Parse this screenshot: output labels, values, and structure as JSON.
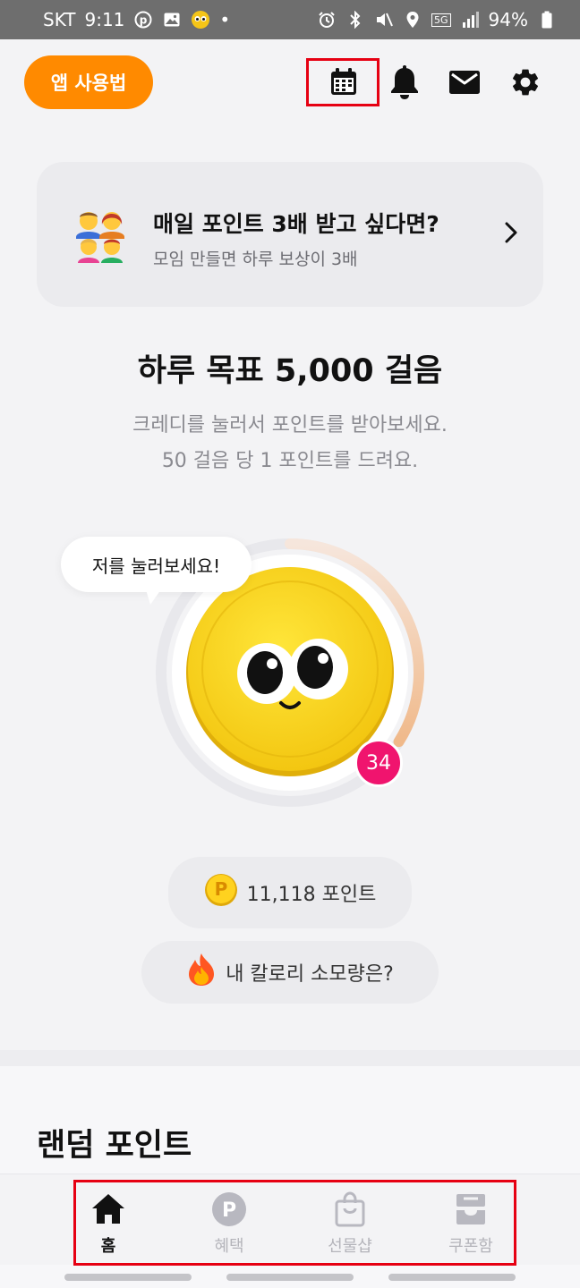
{
  "status_bar": {
    "carrier": "SKT",
    "time": "9:11",
    "notification_dot": "•",
    "battery": "94%",
    "network": "5G",
    "icons": [
      "p-circle-icon",
      "image-icon",
      "emoji-icon",
      "alarm-icon",
      "bluetooth-icon",
      "mute-icon",
      "location-icon",
      "signal-icon",
      "battery-icon"
    ]
  },
  "header": {
    "guide_button": "앱 사용법",
    "icons": [
      "calendar-icon",
      "bell-icon",
      "mail-icon",
      "gear-icon"
    ]
  },
  "promo": {
    "title": "매일 포인트 3배 받고 싶다면?",
    "subtitle": "모임 만들면 하루 보상이 3배",
    "emoji_icon": "family-icon"
  },
  "goal": {
    "title": "하루 목표 5,000 걸음",
    "desc_line1": "크레디를 눌러서 포인트를 받아보세요.",
    "desc_line2": "50 걸음 당 1 포인트를 드려요."
  },
  "coin": {
    "bubble": "저를 눌러보세요!",
    "badge_count": "34",
    "progress_fraction": 0.34
  },
  "points": {
    "label": "11,118 포인트",
    "icon": "point-coin-icon"
  },
  "calorie": {
    "label": "내 칼로리 소모량은?",
    "icon": "fire-icon"
  },
  "random_section": {
    "title": "랜덤 포인트"
  },
  "bottom_nav": {
    "items": [
      {
        "label": "홈",
        "icon": "home-icon",
        "active": true
      },
      {
        "label": "혜택",
        "icon": "benefit-p-icon",
        "active": false
      },
      {
        "label": "선물샵",
        "icon": "shopping-bag-icon",
        "active": false
      },
      {
        "label": "쿠폰함",
        "icon": "inbox-icon",
        "active": false
      }
    ]
  },
  "colors": {
    "accent": "#ff8a00",
    "badge": "#f0146e",
    "coin": "#f7d21b",
    "highlight": "#e60012"
  }
}
